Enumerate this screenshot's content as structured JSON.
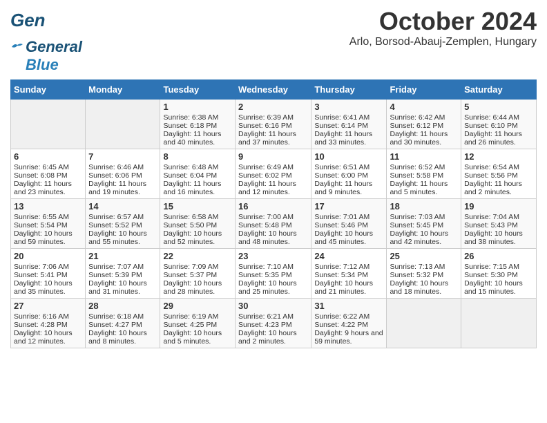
{
  "header": {
    "logo_general": "General",
    "logo_blue": "Blue",
    "month": "October 2024",
    "location": "Arlo, Borsod-Abauj-Zemplen, Hungary"
  },
  "weekdays": [
    "Sunday",
    "Monday",
    "Tuesday",
    "Wednesday",
    "Thursday",
    "Friday",
    "Saturday"
  ],
  "weeks": [
    [
      {
        "day": "",
        "empty": true
      },
      {
        "day": "",
        "empty": true
      },
      {
        "day": "1",
        "sunrise": "6:38 AM",
        "sunset": "6:18 PM",
        "daylight": "11 hours and 40 minutes."
      },
      {
        "day": "2",
        "sunrise": "6:39 AM",
        "sunset": "6:16 PM",
        "daylight": "11 hours and 37 minutes."
      },
      {
        "day": "3",
        "sunrise": "6:41 AM",
        "sunset": "6:14 PM",
        "daylight": "11 hours and 33 minutes."
      },
      {
        "day": "4",
        "sunrise": "6:42 AM",
        "sunset": "6:12 PM",
        "daylight": "11 hours and 30 minutes."
      },
      {
        "day": "5",
        "sunrise": "6:44 AM",
        "sunset": "6:10 PM",
        "daylight": "11 hours and 26 minutes."
      }
    ],
    [
      {
        "day": "6",
        "sunrise": "6:45 AM",
        "sunset": "6:08 PM",
        "daylight": "11 hours and 23 minutes."
      },
      {
        "day": "7",
        "sunrise": "6:46 AM",
        "sunset": "6:06 PM",
        "daylight": "11 hours and 19 minutes."
      },
      {
        "day": "8",
        "sunrise": "6:48 AM",
        "sunset": "6:04 PM",
        "daylight": "11 hours and 16 minutes."
      },
      {
        "day": "9",
        "sunrise": "6:49 AM",
        "sunset": "6:02 PM",
        "daylight": "11 hours and 12 minutes."
      },
      {
        "day": "10",
        "sunrise": "6:51 AM",
        "sunset": "6:00 PM",
        "daylight": "11 hours and 9 minutes."
      },
      {
        "day": "11",
        "sunrise": "6:52 AM",
        "sunset": "5:58 PM",
        "daylight": "11 hours and 5 minutes."
      },
      {
        "day": "12",
        "sunrise": "6:54 AM",
        "sunset": "5:56 PM",
        "daylight": "11 hours and 2 minutes."
      }
    ],
    [
      {
        "day": "13",
        "sunrise": "6:55 AM",
        "sunset": "5:54 PM",
        "daylight": "10 hours and 59 minutes."
      },
      {
        "day": "14",
        "sunrise": "6:57 AM",
        "sunset": "5:52 PM",
        "daylight": "10 hours and 55 minutes."
      },
      {
        "day": "15",
        "sunrise": "6:58 AM",
        "sunset": "5:50 PM",
        "daylight": "10 hours and 52 minutes."
      },
      {
        "day": "16",
        "sunrise": "7:00 AM",
        "sunset": "5:48 PM",
        "daylight": "10 hours and 48 minutes."
      },
      {
        "day": "17",
        "sunrise": "7:01 AM",
        "sunset": "5:46 PM",
        "daylight": "10 hours and 45 minutes."
      },
      {
        "day": "18",
        "sunrise": "7:03 AM",
        "sunset": "5:45 PM",
        "daylight": "10 hours and 42 minutes."
      },
      {
        "day": "19",
        "sunrise": "7:04 AM",
        "sunset": "5:43 PM",
        "daylight": "10 hours and 38 minutes."
      }
    ],
    [
      {
        "day": "20",
        "sunrise": "7:06 AM",
        "sunset": "5:41 PM",
        "daylight": "10 hours and 35 minutes."
      },
      {
        "day": "21",
        "sunrise": "7:07 AM",
        "sunset": "5:39 PM",
        "daylight": "10 hours and 31 minutes."
      },
      {
        "day": "22",
        "sunrise": "7:09 AM",
        "sunset": "5:37 PM",
        "daylight": "10 hours and 28 minutes."
      },
      {
        "day": "23",
        "sunrise": "7:10 AM",
        "sunset": "5:35 PM",
        "daylight": "10 hours and 25 minutes."
      },
      {
        "day": "24",
        "sunrise": "7:12 AM",
        "sunset": "5:34 PM",
        "daylight": "10 hours and 21 minutes."
      },
      {
        "day": "25",
        "sunrise": "7:13 AM",
        "sunset": "5:32 PM",
        "daylight": "10 hours and 18 minutes."
      },
      {
        "day": "26",
        "sunrise": "7:15 AM",
        "sunset": "5:30 PM",
        "daylight": "10 hours and 15 minutes."
      }
    ],
    [
      {
        "day": "27",
        "sunrise": "6:16 AM",
        "sunset": "4:28 PM",
        "daylight": "10 hours and 12 minutes."
      },
      {
        "day": "28",
        "sunrise": "6:18 AM",
        "sunset": "4:27 PM",
        "daylight": "10 hours and 8 minutes."
      },
      {
        "day": "29",
        "sunrise": "6:19 AM",
        "sunset": "4:25 PM",
        "daylight": "10 hours and 5 minutes."
      },
      {
        "day": "30",
        "sunrise": "6:21 AM",
        "sunset": "4:23 PM",
        "daylight": "10 hours and 2 minutes."
      },
      {
        "day": "31",
        "sunrise": "6:22 AM",
        "sunset": "4:22 PM",
        "daylight": "9 hours and 59 minutes."
      },
      {
        "day": "",
        "empty": true
      },
      {
        "day": "",
        "empty": true
      }
    ]
  ],
  "labels": {
    "sunrise": "Sunrise:",
    "sunset": "Sunset:",
    "daylight": "Daylight:"
  }
}
